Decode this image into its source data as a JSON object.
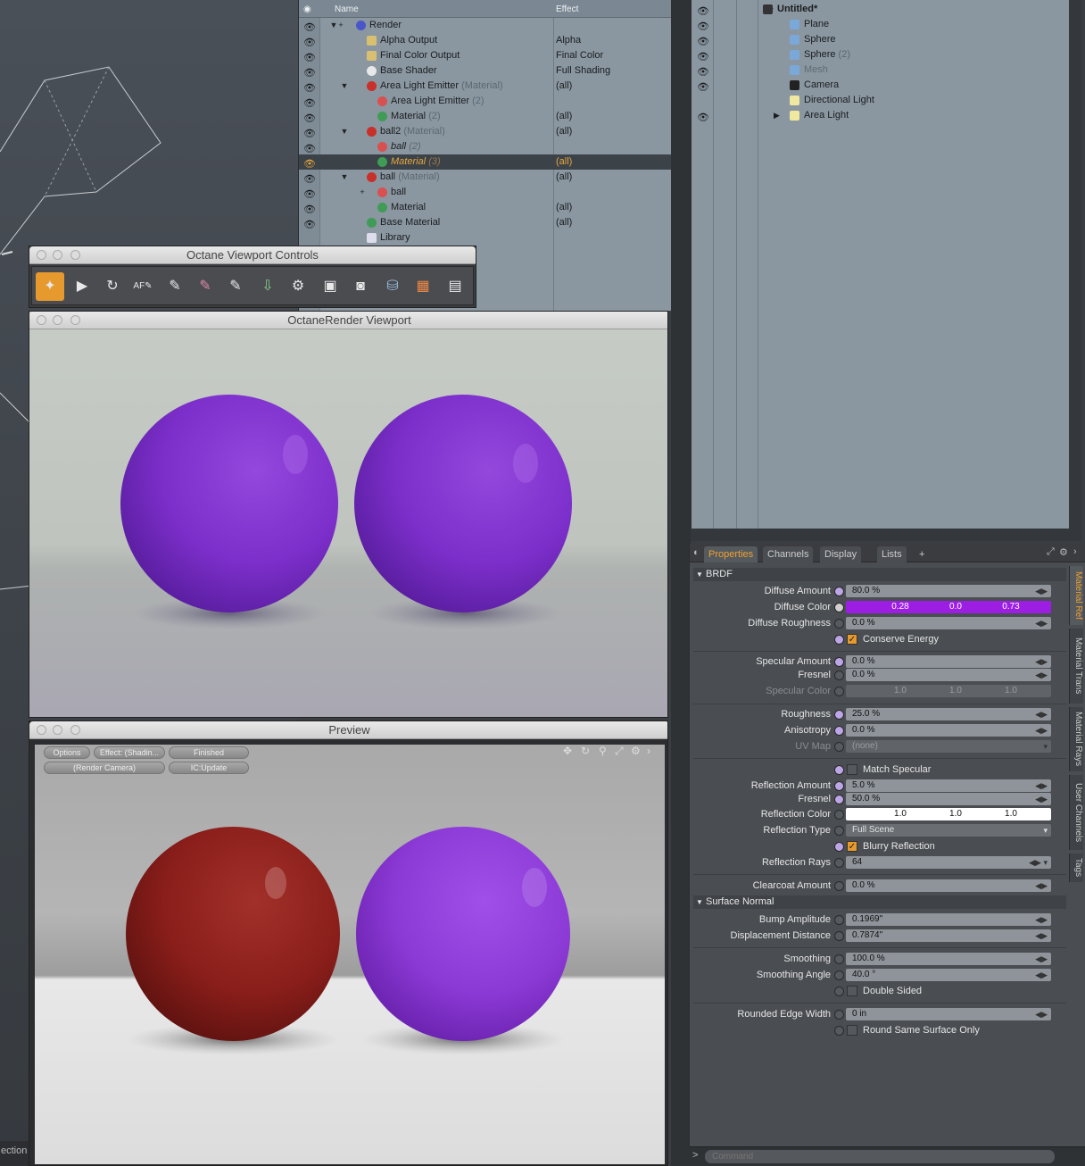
{
  "status_left": "ection",
  "shader_tree": {
    "columns": {
      "name": "Name",
      "effect": "Effect"
    },
    "rows": [
      {
        "indent": 0,
        "toggle": "▼",
        "plus": true,
        "label": "Render",
        "sub": "",
        "effect": "",
        "icon": "blue-sphere",
        "selected": false
      },
      {
        "indent": 1,
        "toggle": "",
        "plus": false,
        "label": "Alpha Output",
        "sub": "",
        "effect": "Alpha",
        "icon": "output",
        "selected": false
      },
      {
        "indent": 1,
        "toggle": "",
        "plus": false,
        "label": "Final Color Output",
        "sub": "",
        "effect": "Final Color",
        "icon": "output",
        "selected": false
      },
      {
        "indent": 1,
        "toggle": "",
        "plus": false,
        "label": "Base Shader",
        "sub": "",
        "effect": "Full Shading",
        "icon": "white-sphere",
        "selected": false
      },
      {
        "indent": 1,
        "toggle": "▼",
        "plus": false,
        "label": "Area Light Emitter",
        "sub": "(Material)",
        "effect": "(all)",
        "icon": "red-mask",
        "selected": false
      },
      {
        "indent": 2,
        "toggle": "",
        "plus": false,
        "label": "Area Light Emitter",
        "sub": "(2)",
        "effect": "",
        "icon": "red-star",
        "selected": false
      },
      {
        "indent": 2,
        "toggle": "",
        "plus": false,
        "label": "Material",
        "sub": "(2)",
        "effect": "(all)",
        "icon": "green-sphere",
        "selected": false
      },
      {
        "indent": 1,
        "toggle": "▼",
        "plus": false,
        "label": "ball2",
        "sub": "(Material)",
        "effect": "(all)",
        "icon": "red-mask",
        "selected": false
      },
      {
        "indent": 2,
        "toggle": "",
        "plus": false,
        "label": "ball",
        "sub": "(2)",
        "effect": "",
        "icon": "red-star",
        "selected": false,
        "italic": true
      },
      {
        "indent": 2,
        "toggle": "",
        "plus": false,
        "label": "Material",
        "sub": "(3)",
        "effect": "(all)",
        "icon": "green-sphere",
        "selected": true,
        "italic": true
      },
      {
        "indent": 1,
        "toggle": "▼",
        "plus": false,
        "label": "ball",
        "sub": "(Material)",
        "effect": "(all)",
        "icon": "red-mask",
        "selected": false
      },
      {
        "indent": 2,
        "toggle": "",
        "plus": true,
        "label": "ball",
        "sub": "",
        "effect": "",
        "icon": "red-star",
        "selected": false
      },
      {
        "indent": 2,
        "toggle": "",
        "plus": false,
        "label": "Material",
        "sub": "",
        "effect": "(all)",
        "icon": "green-sphere",
        "selected": false
      },
      {
        "indent": 1,
        "toggle": "",
        "plus": false,
        "label": "Base Material",
        "sub": "",
        "effect": "(all)",
        "icon": "green-sphere",
        "selected": false
      },
      {
        "indent": 1,
        "toggle": "",
        "plus": false,
        "label": "Library",
        "sub": "",
        "effect": "",
        "icon": "folder",
        "selected": false
      }
    ]
  },
  "items_list": {
    "rows": [
      {
        "indent": 0,
        "label": "Untitled*",
        "sub": "",
        "icon": "scene-icon",
        "eye": true,
        "bold": true
      },
      {
        "indent": 1,
        "label": "Plane",
        "sub": "",
        "icon": "mesh-icon",
        "eye": true
      },
      {
        "indent": 1,
        "label": "Sphere",
        "sub": "",
        "icon": "mesh-icon",
        "eye": true
      },
      {
        "indent": 1,
        "label": "Sphere",
        "sub": "(2)",
        "icon": "mesh-icon",
        "eye": true
      },
      {
        "indent": 1,
        "label": "Mesh",
        "sub": "",
        "icon": "mesh-icon",
        "eye": true,
        "dim": true
      },
      {
        "indent": 1,
        "label": "Camera",
        "sub": "",
        "icon": "camera-icon",
        "eye": true
      },
      {
        "indent": 1,
        "label": "Directional Light",
        "sub": "",
        "icon": "light-icon",
        "eye": false
      },
      {
        "indent": 1,
        "label": "Area Light",
        "sub": "",
        "icon": "light-icon",
        "eye": true,
        "expand": true
      }
    ]
  },
  "ctrl_window": {
    "title": "Octane Viewport Controls"
  },
  "viewport_window": {
    "title": "OctaneRender Viewport"
  },
  "preview_window": {
    "title": "Preview",
    "buttons": {
      "options": "Options",
      "effect": "Effect: (Shadin...",
      "status": "Finished",
      "camera": "(Render Camera)",
      "update": "IC:Update"
    }
  },
  "props": {
    "tabs": {
      "properties": "Properties",
      "channels": "Channels",
      "display": "Display",
      "lists": "Lists",
      "add": "+"
    },
    "side_tabs": [
      "Material Ref",
      "Material Trans",
      "Material Rays",
      "User Channels",
      "Tags"
    ],
    "sections": {
      "brdf": "BRDF",
      "surface_normal": "Surface Normal"
    },
    "diffuse_amount": {
      "label": "Diffuse Amount",
      "value": "80.0 %"
    },
    "diffuse_color": {
      "label": "Diffuse Color",
      "r": "0.28",
      "g": "0.0",
      "b": "0.73",
      "color": "#9d1ee3"
    },
    "diffuse_roughness": {
      "label": "Diffuse Roughness",
      "value": "0.0 %"
    },
    "conserve_energy": {
      "label": "Conserve Energy"
    },
    "specular_amount": {
      "label": "Specular Amount",
      "value": "0.0 %"
    },
    "fresnel1": {
      "label": "Fresnel",
      "value": "0.0 %"
    },
    "specular_color": {
      "label": "Specular Color",
      "r": "1.0",
      "g": "1.0",
      "b": "1.0"
    },
    "roughness": {
      "label": "Roughness",
      "value": "25.0 %"
    },
    "anisotropy": {
      "label": "Anisotropy",
      "value": "0.0 %"
    },
    "uv_map": {
      "label": "UV Map",
      "value": "(none)"
    },
    "match_specular": {
      "label": "Match Specular"
    },
    "reflection_amount": {
      "label": "Reflection Amount",
      "value": "5.0 %"
    },
    "fresnel2": {
      "label": "Fresnel",
      "value": "50.0 %"
    },
    "reflection_color": {
      "label": "Reflection Color",
      "r": "1.0",
      "g": "1.0",
      "b": "1.0"
    },
    "reflection_type": {
      "label": "Reflection Type",
      "value": "Full Scene"
    },
    "blurry_reflection": {
      "label": "Blurry Reflection"
    },
    "reflection_rays": {
      "label": "Reflection Rays",
      "value": "64"
    },
    "clearcoat_amount": {
      "label": "Clearcoat Amount",
      "value": "0.0 %"
    },
    "bump_amplitude": {
      "label": "Bump Amplitude",
      "value": "0.1969\""
    },
    "displacement_distance": {
      "label": "Displacement Distance",
      "value": "0.7874\""
    },
    "smoothing": {
      "label": "Smoothing",
      "value": "100.0 %"
    },
    "smoothing_angle": {
      "label": "Smoothing Angle",
      "value": "40.0 °"
    },
    "double_sided": {
      "label": "Double Sided"
    },
    "rounded_edge_width": {
      "label": "Rounded Edge Width",
      "value": "0 in"
    },
    "round_same_surface": {
      "label": "Round Same Surface Only"
    }
  },
  "command": {
    "placeholder": "Command",
    "prompt": ">"
  },
  "colors": {
    "accent": "#e69a2e",
    "ball_purple": "#8c3ad6",
    "ball_red": "#8a1e1a"
  }
}
